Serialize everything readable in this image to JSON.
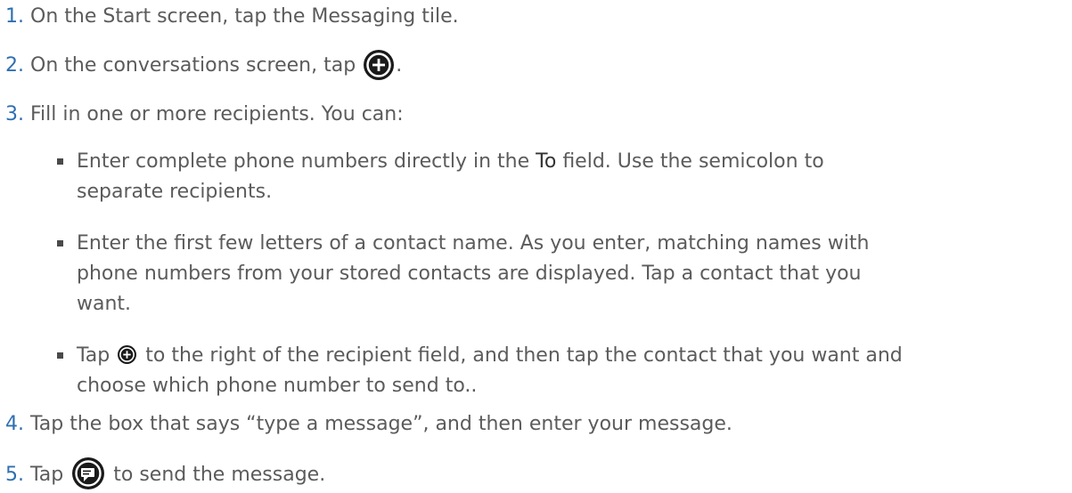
{
  "steps": [
    {
      "num": "1.",
      "text": "On the Start screen, tap the Messaging tile."
    },
    {
      "num": "2.",
      "text_before": "On the conversations screen, tap",
      "text_after": "."
    },
    {
      "num": "3.",
      "text": "Fill in one or more recipients. You can:"
    },
    {
      "num": "4.",
      "text": "Tap the box that says “type a message”, and then enter your message."
    },
    {
      "num": "5.",
      "text_before": "Tap",
      "text_after": "to send the message."
    }
  ],
  "bullets": [
    {
      "before": "Enter complete phone numbers directly in the",
      "field_word": "To",
      "after_line1": "field. Use the semicolon to",
      "line2": "separate recipients."
    },
    {
      "line1": "Enter the first few letters of a contact name. As you enter, matching names with",
      "line2": "phone numbers from your stored contacts are displayed. Tap a contact that you",
      "line3": "want."
    },
    {
      "before": "Tap",
      "after_line1": "to the right of the recipient field, and then tap the contact that you want and",
      "line2": "choose which phone number to send to.."
    }
  ],
  "icons": {
    "add_button": "add-circle-icon",
    "add_small": "add-circle-small-icon",
    "send_button": "send-icon"
  },
  "colors": {
    "step_number": "#2f6fb0",
    "body_text": "#5b5b5b",
    "icon_fill": "#1a1a1a"
  }
}
